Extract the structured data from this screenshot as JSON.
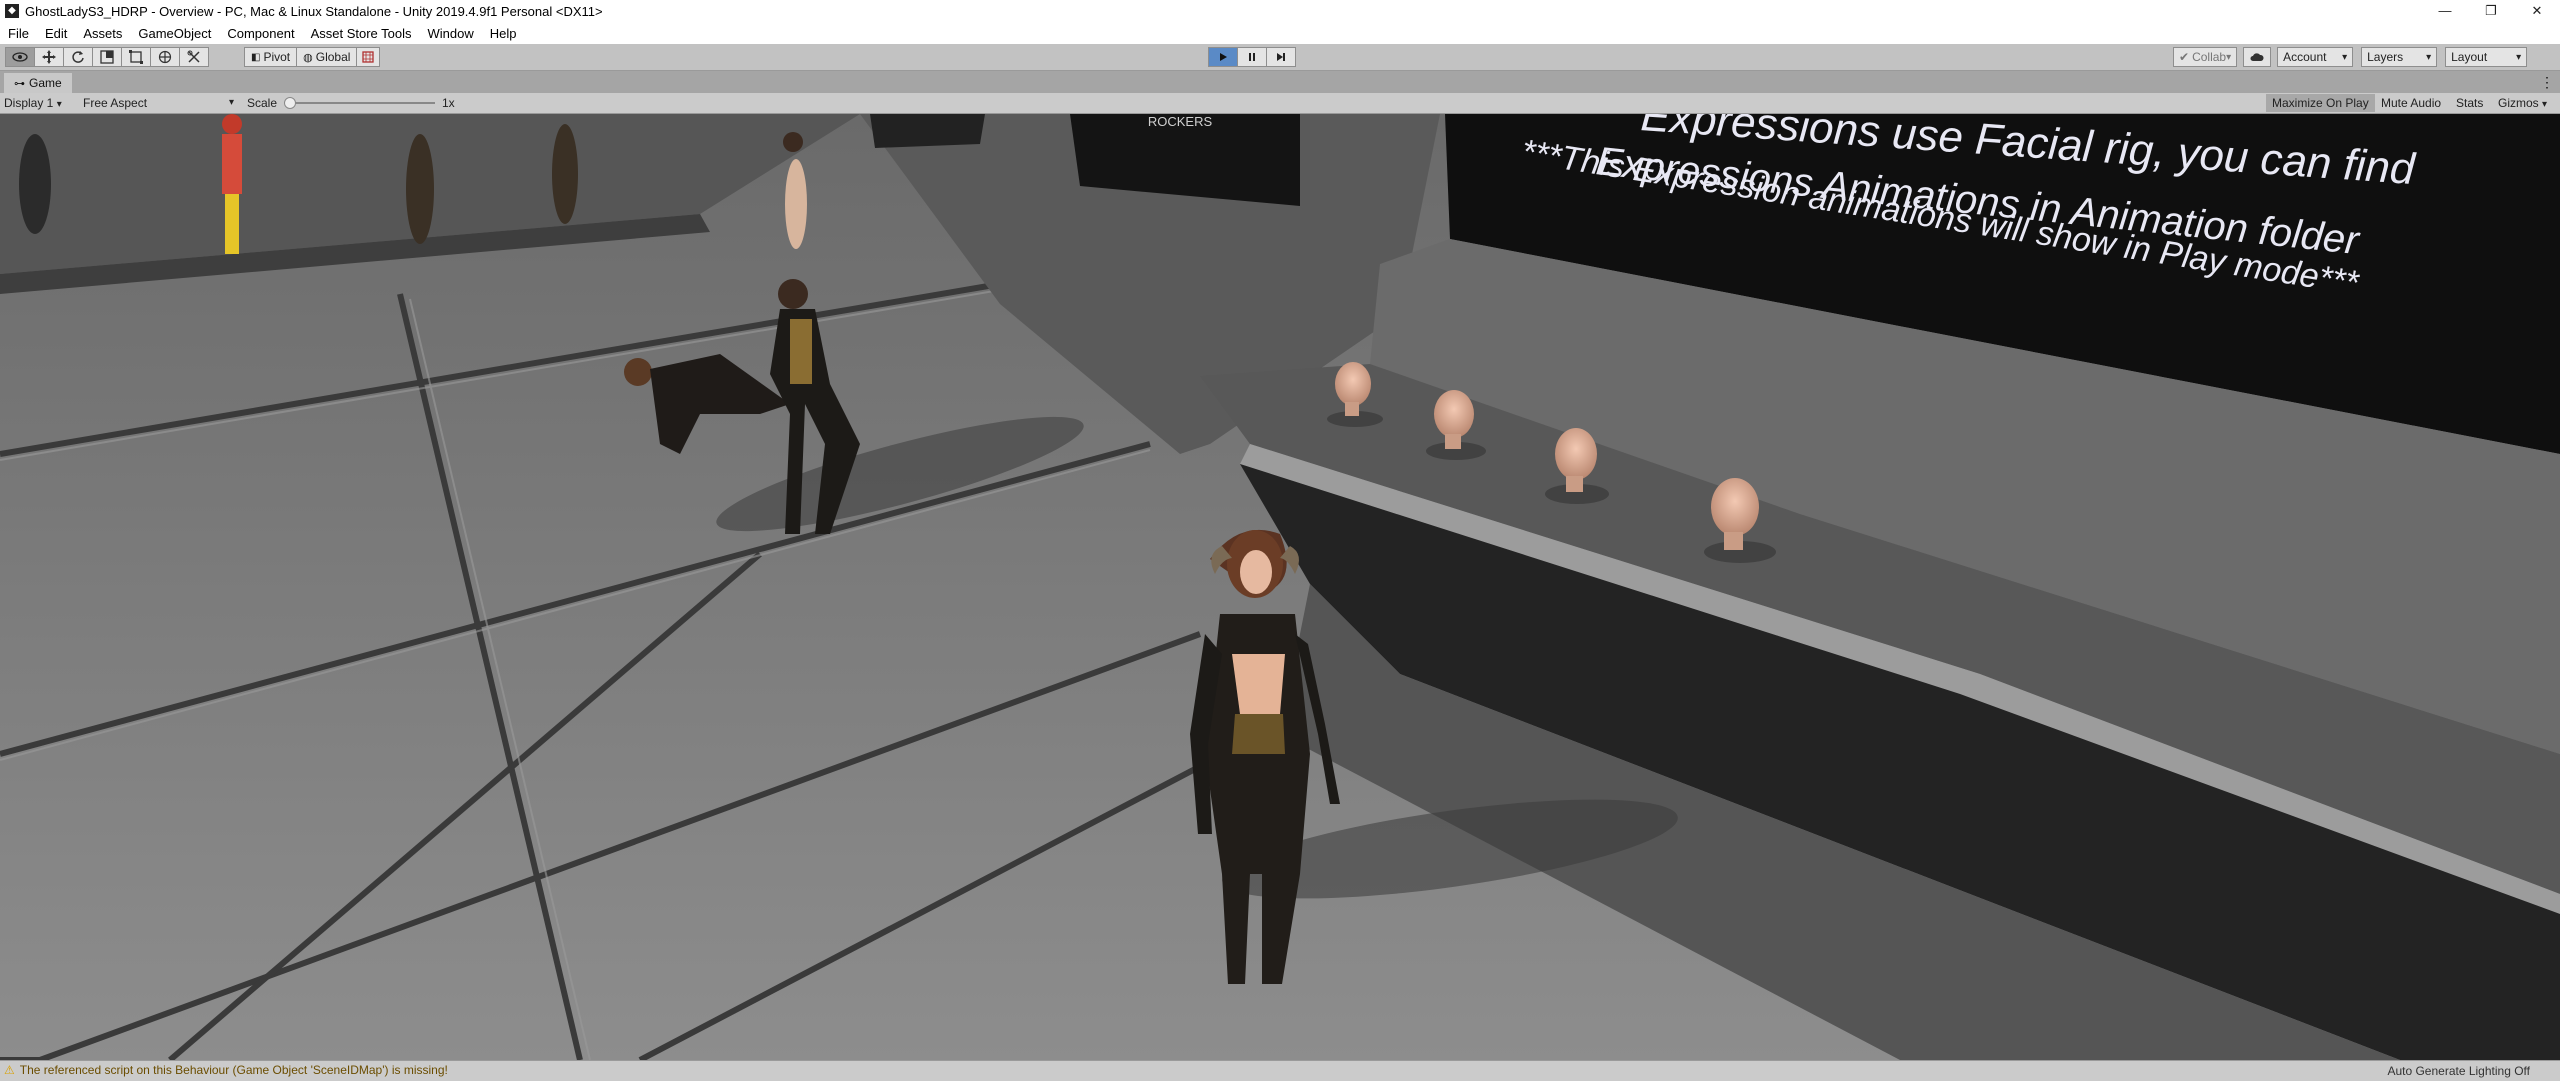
{
  "window": {
    "title": "GhostLadyS3_HDRP - Overview - PC, Mac & Linux Standalone - Unity 2019.4.9f1 Personal <DX11>",
    "controls": [
      "—",
      "❐",
      "✕"
    ]
  },
  "menu": [
    "File",
    "Edit",
    "Assets",
    "GameObject",
    "Component",
    "Asset Store Tools",
    "Window",
    "Help"
  ],
  "toolbar": {
    "pivot_label": "Pivot",
    "global_label": "Global",
    "collab_label": "Collab",
    "account_label": "Account",
    "layers_label": "Layers",
    "layout_label": "Layout",
    "play_state": "playing"
  },
  "game_panel": {
    "tab_label": "Game",
    "display_label": "Display 1",
    "aspect_label": "Free Aspect",
    "scale_label": "Scale",
    "scale_value": "1x",
    "scale_fraction": 0.0,
    "maximize_label": "Maximize On Play",
    "mute_label": "Mute Audio",
    "stats_label": "Stats",
    "gizmos_label": "Gizmos"
  },
  "scene": {
    "sign_lines": [
      "Expressions use Facial rig, you can find",
      "Expressions Animations in Animation folder",
      "***This Expression animations will show in Play mode***"
    ],
    "small_sign_text": "ROCKERS"
  },
  "status": {
    "message": "The referenced script on this Behaviour (Game Object 'SceneIDMap') is missing!",
    "right_text": "Auto Generate Lighting Off"
  },
  "colors": {
    "toolbar_bg": "#c2c2c2",
    "play_active": "#5a8ac6",
    "warning": "#d8a000",
    "floor": "#7c7c7c",
    "wall_dark": "#141414"
  }
}
